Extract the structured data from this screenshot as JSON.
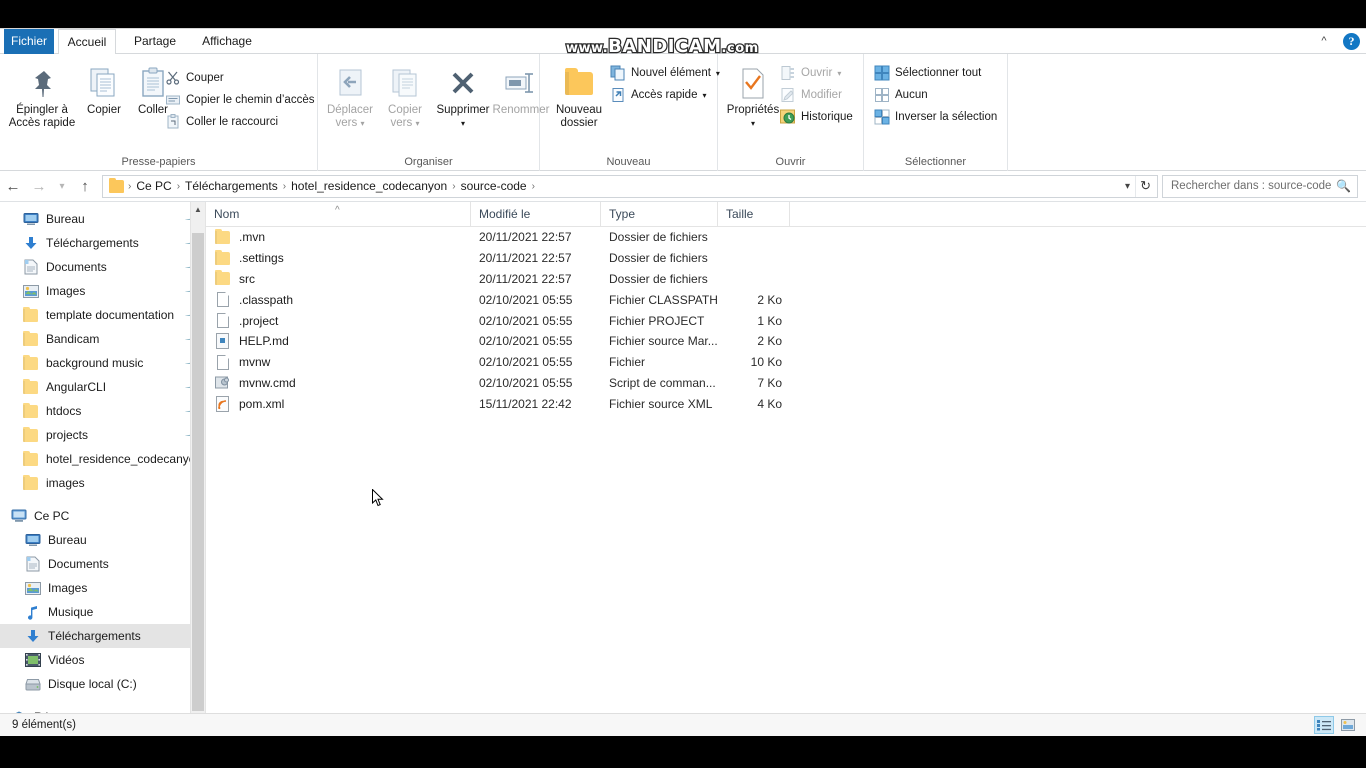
{
  "watermark": {
    "prefix": "www.",
    "brand": "BANDICAM",
    "suffix": ".com"
  },
  "tabs": [
    {
      "label": "Fichier",
      "key": "file"
    },
    {
      "label": "Accueil",
      "key": "accueil"
    },
    {
      "label": "Partage",
      "key": "partage"
    },
    {
      "label": "Affichage",
      "key": "affichage"
    }
  ],
  "titlebar": {
    "collapse_ribbon_icon": "chevron-up-icon",
    "help_label": "?"
  },
  "ribbon": {
    "groups": [
      {
        "name": "Presse-papiers",
        "label": "Presse-papiers"
      },
      {
        "name": "Organiser",
        "label": "Organiser"
      },
      {
        "name": "Nouveau",
        "label": "Nouveau"
      },
      {
        "name": "Ouvrir",
        "label": "Ouvrir"
      },
      {
        "name": "Selectionner",
        "label": "Sélectionner"
      }
    ],
    "pin_line1": "Épingler à",
    "pin_line2": "Accès rapide",
    "copy_label": "Copier",
    "paste_label": "Coller",
    "cut_label": "Couper",
    "copy_path_label": "Copier le chemin d’accès",
    "paste_shortcut_label": "Coller le raccourci",
    "move_to_line1": "Déplacer",
    "move_to_line2": "vers",
    "copy_to_line1": "Copier",
    "copy_to_line2": "vers",
    "delete_label": "Supprimer",
    "rename_label": "Renommer",
    "new_folder_line1": "Nouveau",
    "new_folder_line2": "dossier",
    "new_item_label": "Nouvel élément",
    "quick_access_label": "Accès rapide",
    "properties_label": "Propriétés",
    "open_label": "Ouvrir",
    "edit_label": "Modifier",
    "history_label": "Historique",
    "select_all_label": "Sélectionner tout",
    "select_none_label": "Aucun",
    "invert_selection_label": "Inverser la sélection"
  },
  "address": {
    "back_icon": "arrow-left-icon",
    "forward_icon": "arrow-right-icon",
    "recent_icon": "chevron-down-icon",
    "up_icon": "arrow-up-icon",
    "crumbs": [
      "Ce PC",
      "Téléchargements",
      "hotel_residence_codecanyon",
      "source-code"
    ],
    "refresh_icon": "refresh-icon",
    "dropdown_icon": "chevron-down-icon"
  },
  "search": {
    "placeholder": "Rechercher dans : source-code",
    "icon": "search-icon"
  },
  "sidebar": {
    "quick_access": [
      {
        "label": "Bureau",
        "icon": "desktop-icon",
        "pinned": true
      },
      {
        "label": "Téléchargements",
        "icon": "downloads-icon",
        "pinned": true
      },
      {
        "label": "Documents",
        "icon": "documents-icon",
        "pinned": true
      },
      {
        "label": "Images",
        "icon": "pictures-icon",
        "pinned": true
      },
      {
        "label": "template documentation",
        "icon": "folder-icon",
        "pinned": true
      },
      {
        "label": "Bandicam",
        "icon": "folder-icon",
        "pinned": true
      },
      {
        "label": "background music",
        "icon": "folder-icon",
        "pinned": true
      },
      {
        "label": "AngularCLI",
        "icon": "folder-icon",
        "pinned": true
      },
      {
        "label": "htdocs",
        "icon": "folder-icon",
        "pinned": true
      },
      {
        "label": "projects",
        "icon": "folder-icon",
        "pinned": true
      },
      {
        "label": "hotel_residence_codecanyon",
        "icon": "folder-icon",
        "pinned": false
      },
      {
        "label": "images",
        "icon": "folder-icon",
        "pinned": false
      }
    ],
    "this_pc": {
      "label": "Ce PC",
      "icon": "computer-icon"
    },
    "this_pc_children": [
      {
        "label": "Bureau",
        "icon": "desktop-icon",
        "selected": false
      },
      {
        "label": "Documents",
        "icon": "documents-icon",
        "selected": false
      },
      {
        "label": "Images",
        "icon": "pictures-icon",
        "selected": false
      },
      {
        "label": "Musique",
        "icon": "music-icon",
        "selected": false
      },
      {
        "label": "Téléchargements",
        "icon": "downloads-icon",
        "selected": true
      },
      {
        "label": "Vidéos",
        "icon": "videos-icon",
        "selected": false
      },
      {
        "label": "Disque local (C:)",
        "icon": "drive-icon",
        "selected": false
      }
    ],
    "network": {
      "label": "Réseau",
      "icon": "network-icon"
    }
  },
  "filelist": {
    "columns": [
      {
        "label": "Nom",
        "key": "name"
      },
      {
        "label": "Modifié le",
        "key": "modified"
      },
      {
        "label": "Type",
        "key": "type"
      },
      {
        "label": "Taille",
        "key": "size"
      }
    ],
    "sort_indicator": "sort-ascending-icon",
    "rows": [
      {
        "name": ".mvn",
        "modified": "20/11/2021 22:57",
        "type": "Dossier de fichiers",
        "size": "",
        "icon": "folder-icon"
      },
      {
        "name": ".settings",
        "modified": "20/11/2021 22:57",
        "type": "Dossier de fichiers",
        "size": "",
        "icon": "folder-icon"
      },
      {
        "name": "src",
        "modified": "20/11/2021 22:57",
        "type": "Dossier de fichiers",
        "size": "",
        "icon": "folder-icon"
      },
      {
        "name": ".classpath",
        "modified": "02/10/2021 05:55",
        "type": "Fichier CLASSPATH",
        "size": "2 Ko",
        "icon": "file-icon"
      },
      {
        "name": ".project",
        "modified": "02/10/2021 05:55",
        "type": "Fichier PROJECT",
        "size": "1 Ko",
        "icon": "file-icon"
      },
      {
        "name": "HELP.md",
        "modified": "02/10/2021 05:55",
        "type": "Fichier source Mar...",
        "size": "2 Ko",
        "icon": "markdown-icon"
      },
      {
        "name": "mvnw",
        "modified": "02/10/2021 05:55",
        "type": "Fichier",
        "size": "10 Ko",
        "icon": "file-icon"
      },
      {
        "name": "mvnw.cmd",
        "modified": "02/10/2021 05:55",
        "type": "Script de comman...",
        "size": "7 Ko",
        "icon": "cmd-script-icon"
      },
      {
        "name": "pom.xml",
        "modified": "15/11/2021 22:42",
        "type": "Fichier source XML",
        "size": "4 Ko",
        "icon": "xml-icon"
      }
    ]
  },
  "statusbar": {
    "item_count": "9 élément(s)",
    "details_view_icon": "details-view-icon",
    "large_icons_view_icon": "large-icons-view-icon"
  },
  "colors": {
    "accent": "#1a6fb5",
    "folder": "#fcd983",
    "selection": "#e4e4e4",
    "view_active": "#cde8f7"
  }
}
